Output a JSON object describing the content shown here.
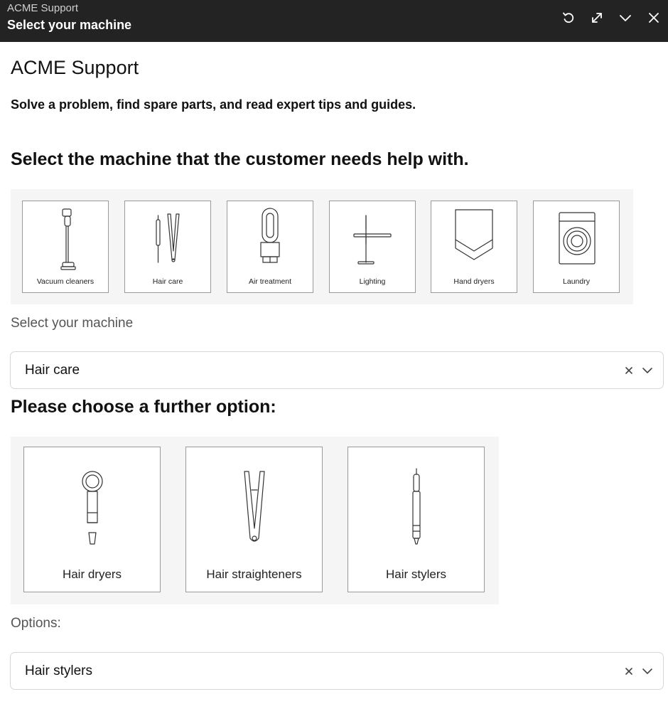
{
  "window": {
    "app_name": "ACME Support",
    "title": "Select your machine",
    "icons": [
      "refresh-icon",
      "expand-icon",
      "chevron-down-icon",
      "close-icon"
    ]
  },
  "header": {
    "title": "ACME Support",
    "description": "Solve a problem, find spare parts, and read expert tips and guides."
  },
  "machine_prompt": "Select the machine that the customer needs help with.",
  "categories": [
    {
      "label": "Vacuum cleaners",
      "icon": "vacuum-icon"
    },
    {
      "label": "Hair care",
      "icon": "hair-care-icon"
    },
    {
      "label": "Air treatment",
      "icon": "air-treatment-icon"
    },
    {
      "label": "Lighting",
      "icon": "lamp-icon"
    },
    {
      "label": "Hand dryers",
      "icon": "hand-dryer-icon"
    },
    {
      "label": "Laundry",
      "icon": "washing-machine-icon"
    }
  ],
  "machine_select": {
    "label": "Select your machine",
    "value": "Hair care"
  },
  "further_prompt": "Please choose a further option:",
  "options": [
    {
      "label": "Hair dryers",
      "icon": "hair-dryer-icon"
    },
    {
      "label": "Hair straighteners",
      "icon": "hair-straightener-icon"
    },
    {
      "label": "Hair stylers",
      "icon": "hair-styler-icon"
    }
  ],
  "options_select": {
    "label": "Options:",
    "value": "Hair stylers"
  }
}
